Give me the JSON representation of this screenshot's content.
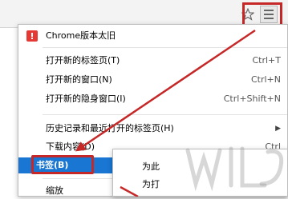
{
  "toolbar": {
    "star_icon": "star-icon",
    "menu_icon": "hamburger-menu-icon"
  },
  "menu": {
    "chrome_item": "Chrome版本太旧",
    "items": [
      {
        "label": "打开新的标签页(T)",
        "shortcut": "Ctrl+T"
      },
      {
        "label": "打开新的窗口(N)",
        "shortcut": "Ctrl+N"
      },
      {
        "label": "打开新的隐身窗口(I)",
        "shortcut": "Ctrl+Shift+N"
      },
      {
        "label": "历史记录和最近打开的标签页(H)",
        "shortcut": ""
      },
      {
        "label": "下载内容(D)",
        "shortcut": "Ctrl"
      },
      {
        "label": "书签(B)",
        "shortcut": ""
      },
      {
        "label": "缩放",
        "shortcut": ""
      }
    ]
  },
  "submenu": {
    "items": [
      "为此",
      "为打"
    ]
  },
  "colors": {
    "highlight": "#c62828",
    "selected": "#1976d2"
  }
}
